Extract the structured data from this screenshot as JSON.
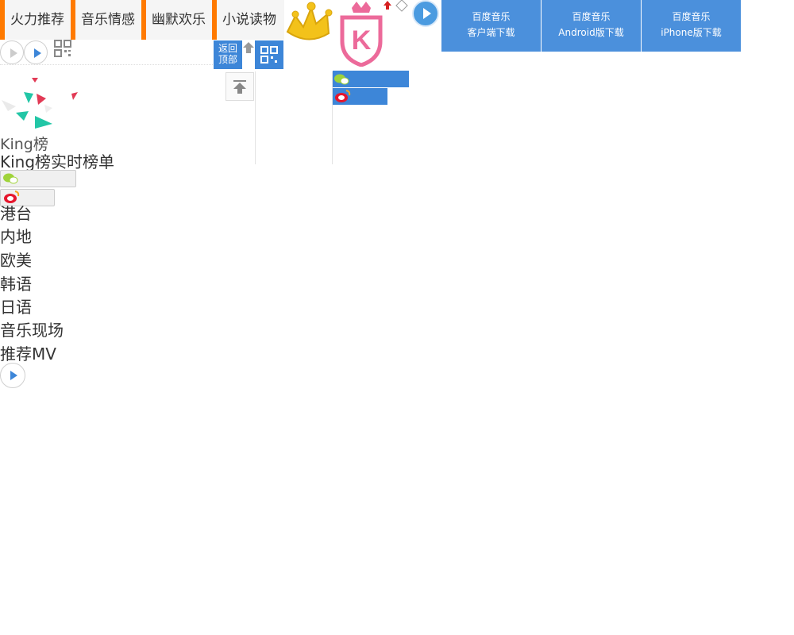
{
  "tabs": [
    {
      "label": "火力推荐"
    },
    {
      "label": "音乐情感"
    },
    {
      "label": "幽默欢乐"
    },
    {
      "label": "小说读物"
    }
  ],
  "back_to_top": {
    "line1": "返回",
    "line2": "顶部"
  },
  "downloads": [
    {
      "line1": "百度音乐",
      "line2": "客户端下载"
    },
    {
      "line1": "百度音乐",
      "line2": "Android版下载"
    },
    {
      "line1": "百度音乐",
      "line2": "iPhone版下载"
    }
  ],
  "king": {
    "logo_text": "King榜",
    "title": "King榜实时榜单"
  },
  "regions": [
    {
      "label": "港台"
    },
    {
      "label": "内地"
    },
    {
      "label": "欧美"
    },
    {
      "label": "韩语"
    },
    {
      "label": "日语"
    },
    {
      "label": "音乐现场"
    },
    {
      "label": "推荐MV"
    }
  ],
  "colors": {
    "accent_orange": "#ff7a00",
    "blue": "#3d86d8",
    "pink": "#ec6a9a",
    "crown_yellow": "#f3c21a"
  }
}
